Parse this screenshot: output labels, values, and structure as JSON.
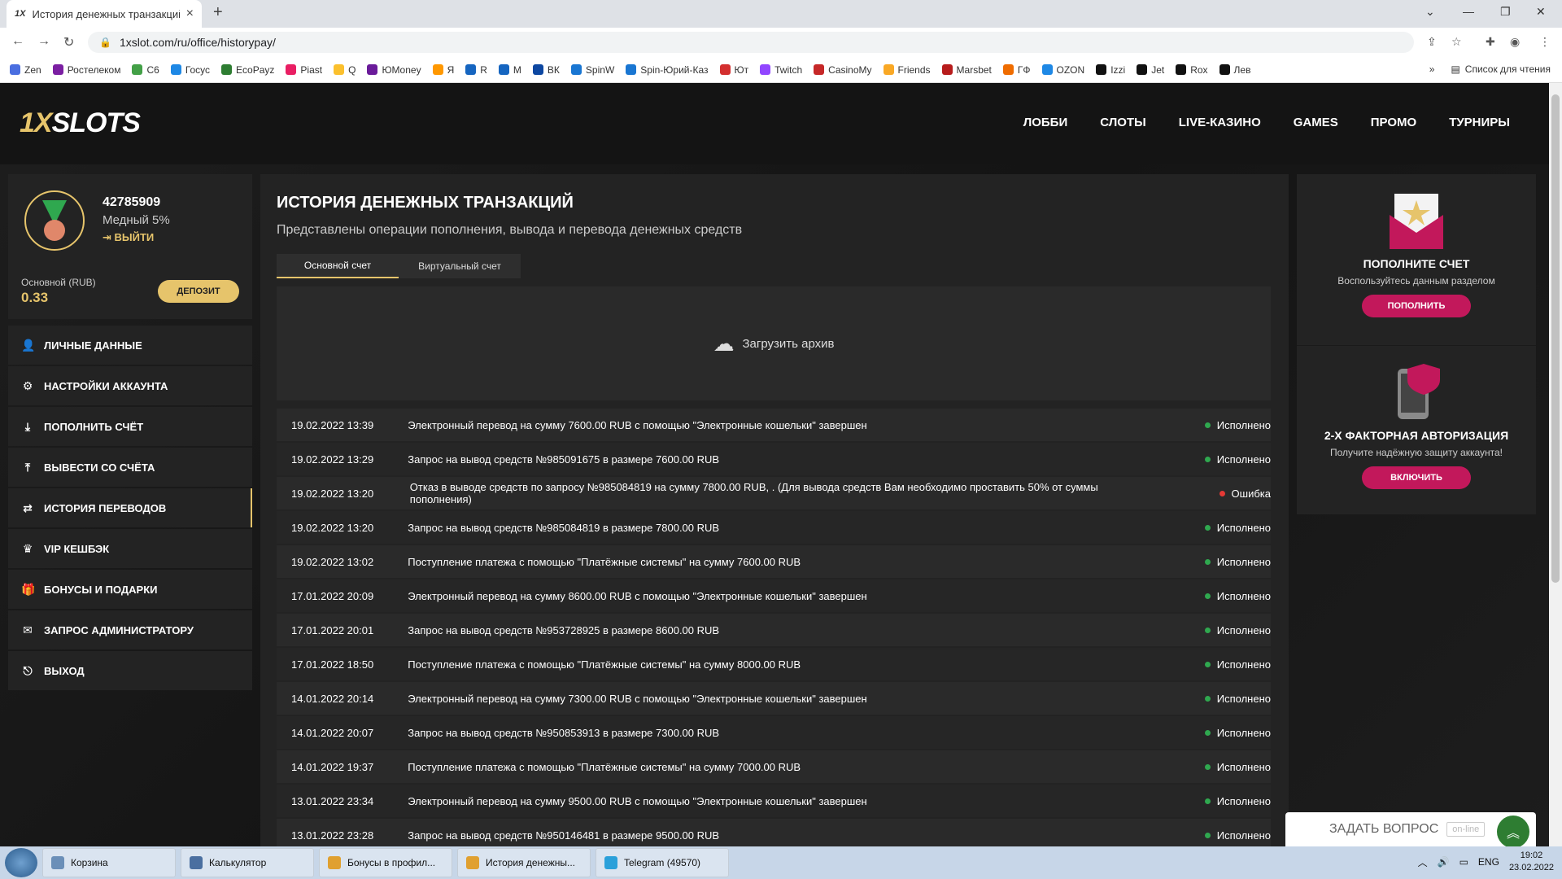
{
  "browser": {
    "tab_title": "История денежных транзакций",
    "tab_favicon": "1X",
    "url": "1xslot.com/ru/office/historypay/",
    "bookmarks": [
      "Zen",
      "Ростелеком",
      "С6",
      "Госус",
      "EcoPayz",
      "Piast",
      "Q",
      "ЮMoney",
      "Я",
      "R",
      "M",
      "ВК",
      "SpinW",
      "Spin-Юрий-Каз",
      "Ют",
      "Twitch",
      "CasinoMy",
      "Friends",
      "Marsbet",
      "ГФ",
      "OZON",
      "Izzi",
      "Jet",
      "Rox",
      "Лев"
    ],
    "bookmarks_more": "»",
    "reading_list": "Список для чтения"
  },
  "site": {
    "logo_a": "1X",
    "logo_b": "SLOTS",
    "nav": [
      "ЛОББИ",
      "СЛОТЫ",
      "LIVE-КАЗИНО",
      "GAMES",
      "ПРОМО",
      "ТУРНИРЫ"
    ]
  },
  "profile": {
    "id": "42785909",
    "level": "Медный 5%",
    "logout": "ВЫЙТИ",
    "balance_label": "Основной (RUB)",
    "balance": "0.33",
    "deposit": "ДЕПОЗИТ"
  },
  "menu": [
    {
      "label": "ЛИЧНЫЕ ДАННЫЕ",
      "icon": "user-icon",
      "glyph": "👤"
    },
    {
      "label": "НАСТРОЙКИ АККАУНТА",
      "icon": "settings-icon",
      "glyph": "⚙"
    },
    {
      "label": "ПОПОЛНИТЬ СЧЁТ",
      "icon": "deposit-icon",
      "glyph": "⤓"
    },
    {
      "label": "ВЫВЕСТИ СО СЧЁТА",
      "icon": "withdraw-icon",
      "glyph": "⤒"
    },
    {
      "label": "ИСТОРИЯ ПЕРЕВОДОВ",
      "icon": "transfer-icon",
      "glyph": "⇄"
    },
    {
      "label": "VIP КЕШБЭК",
      "icon": "crown-icon",
      "glyph": "♛"
    },
    {
      "label": "БОНУСЫ И ПОДАРКИ",
      "icon": "gift-icon",
      "glyph": "🎁"
    },
    {
      "label": "ЗАПРОС АДМИНИСТРАТОРУ",
      "icon": "mail-icon",
      "glyph": "✉"
    },
    {
      "label": "ВЫХОД",
      "icon": "logout-icon",
      "glyph": "⎋"
    }
  ],
  "main": {
    "title": "ИСТОРИЯ ДЕНЕЖНЫХ ТРАНЗАКЦИЙ",
    "subtitle": "Представлены операции пополнения, вывода и перевода денежных средств",
    "tabs": [
      "Основной счет",
      "Виртуальный счет"
    ],
    "upload": "Загрузить архив",
    "rows": [
      {
        "date": "19.02.2022 13:39",
        "desc": "Электронный перевод на сумму 7600.00 RUB с помощью \"Электронные кошельки\" завершен",
        "status": "Исполнено",
        "color": "#2fa84f"
      },
      {
        "date": "19.02.2022 13:29",
        "desc": "Запрос на вывод средств №985091675 в размере 7600.00 RUB",
        "status": "Исполнено",
        "color": "#2fa84f"
      },
      {
        "date": "19.02.2022 13:20",
        "desc": "Отказ в выводе средств по запросу №985084819 на сумму 7800.00 RUB, . (Для вывода средств Вам необходимо проставить 50% от суммы пополнения)",
        "status": "Ошибка",
        "color": "#e53935"
      },
      {
        "date": "19.02.2022 13:20",
        "desc": "Запрос на вывод средств №985084819 в размере 7800.00 RUB",
        "status": "Исполнено",
        "color": "#2fa84f"
      },
      {
        "date": "19.02.2022 13:02",
        "desc": "Поступление платежа с помощью \"Платёжные системы\" на сумму 7600.00 RUB",
        "status": "Исполнено",
        "color": "#2fa84f"
      },
      {
        "date": "17.01.2022 20:09",
        "desc": "Электронный перевод на сумму 8600.00 RUB с помощью \"Электронные кошельки\" завершен",
        "status": "Исполнено",
        "color": "#2fa84f"
      },
      {
        "date": "17.01.2022 20:01",
        "desc": "Запрос на вывод средств №953728925 в размере 8600.00 RUB",
        "status": "Исполнено",
        "color": "#2fa84f"
      },
      {
        "date": "17.01.2022 18:50",
        "desc": "Поступление платежа с помощью \"Платёжные системы\" на сумму 8000.00 RUB",
        "status": "Исполнено",
        "color": "#2fa84f"
      },
      {
        "date": "14.01.2022 20:14",
        "desc": "Электронный перевод на сумму 7300.00 RUB с помощью \"Электронные кошельки\" завершен",
        "status": "Исполнено",
        "color": "#2fa84f"
      },
      {
        "date": "14.01.2022 20:07",
        "desc": "Запрос на вывод средств №950853913 в размере 7300.00 RUB",
        "status": "Исполнено",
        "color": "#2fa84f"
      },
      {
        "date": "14.01.2022 19:37",
        "desc": "Поступление платежа с помощью \"Платёжные системы\" на сумму 7000.00 RUB",
        "status": "Исполнено",
        "color": "#2fa84f"
      },
      {
        "date": "13.01.2022 23:34",
        "desc": "Электронный перевод на сумму 9500.00 RUB с помощью \"Электронные кошельки\" завершен",
        "status": "Исполнено",
        "color": "#2fa84f"
      },
      {
        "date": "13.01.2022 23:28",
        "desc": "Запрос на вывод средств №950146481 в размере 9500.00 RUB",
        "status": "Исполнено",
        "color": "#2fa84f"
      }
    ]
  },
  "promo": {
    "topup_title": "ПОПОЛНИТЕ СЧЕТ",
    "topup_text": "Воспользуйтесь данным разделом",
    "topup_btn": "ПОПОЛНИТЬ",
    "twofa_title": "2-Х ФАКТОРНАЯ АВТОРИЗАЦИЯ",
    "twofa_text": "Получите надёжную защиту аккаунта!",
    "twofa_btn": "ВКЛЮЧИТЬ"
  },
  "chat": {
    "label": "ЗАДАТЬ ВОПРОС",
    "status": "on-line"
  },
  "taskbar": {
    "items": [
      "Корзина",
      "Калькулятор",
      "Бонусы в профил...",
      "История денежны...",
      "Telegram (49570)"
    ],
    "lang": "ENG",
    "time": "19:02",
    "date": "23.02.2022"
  },
  "colors": {
    "accent": "#e6c46b",
    "pink": "#c2185b",
    "success": "#2fa84f",
    "error": "#e53935"
  }
}
